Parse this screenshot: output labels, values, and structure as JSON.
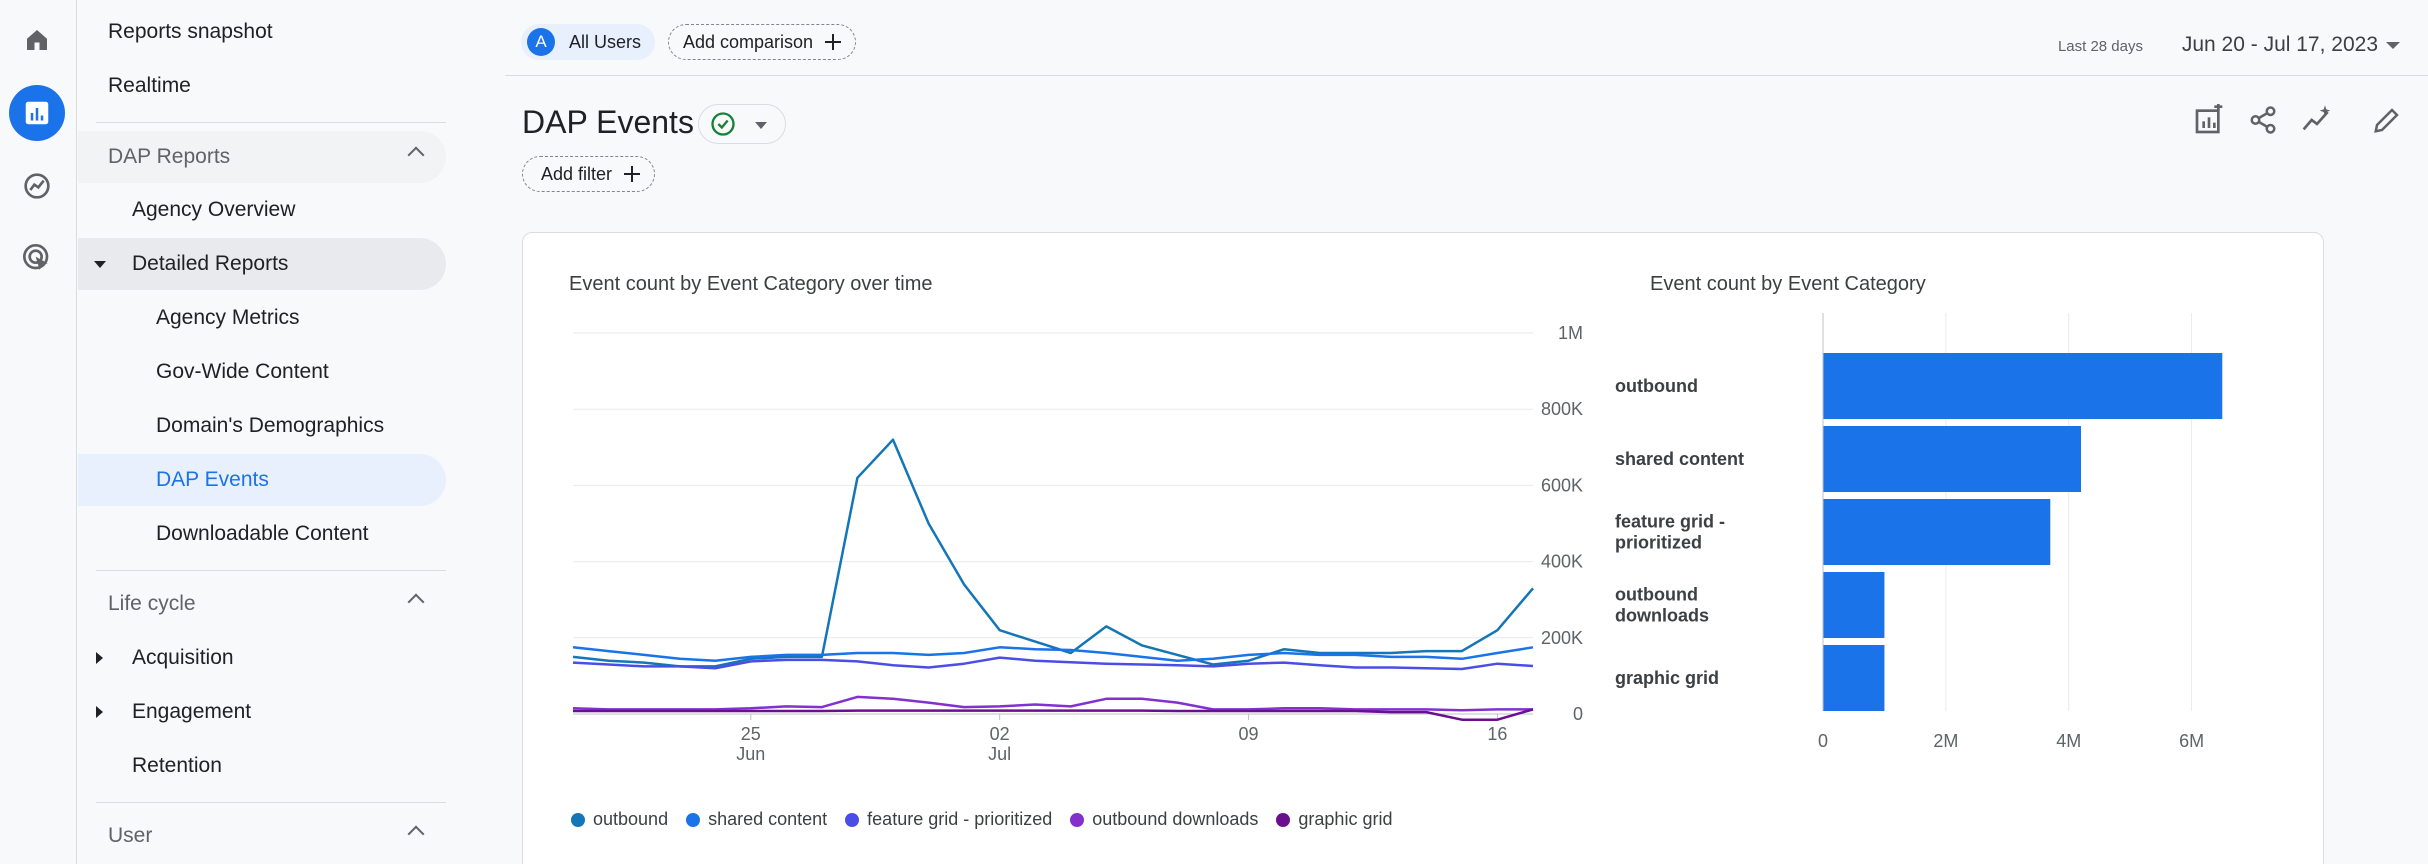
{
  "nav": {
    "items": [
      {
        "label": "Reports snapshot"
      },
      {
        "label": "Realtime"
      }
    ],
    "dap_section": {
      "label": "DAP Reports"
    },
    "agency_overview": "Agency Overview",
    "detailed_reports": "Detailed Reports",
    "detailed_children": [
      "Agency Metrics",
      "Gov-Wide Content",
      "Domain's Demographics",
      "DAP Events",
      "Downloadable Content"
    ],
    "lifecycle_section": "Life cycle",
    "lifecycle_children": [
      "Acquisition",
      "Engagement",
      "Retention"
    ],
    "user_section": "User"
  },
  "topbar": {
    "segment_avatar": "A",
    "segment_label": "All Users",
    "compare_label": "Add comparison",
    "date_caption": "Last 28 days",
    "date_range": "Jun 20 - Jul 17, 2023"
  },
  "page": {
    "title": "DAP Events",
    "add_filter": "Add filter"
  },
  "colors": {
    "outbound": "#1576b7",
    "shared_content": "#1a73e8",
    "feature_grid": "#4a4ee6",
    "outbound_downloads": "#8430ce",
    "graphic_grid": "#6a0f8e",
    "bar": "#1a73e8"
  },
  "chart_data": [
    {
      "type": "line",
      "title": "Event count by Event Category over time",
      "x_tick_labels": [
        {
          "day": "25",
          "month": "Jun"
        },
        {
          "day": "02",
          "month": "Jul"
        },
        {
          "day": "09",
          "month": ""
        },
        {
          "day": "16",
          "month": ""
        }
      ],
      "x": [
        "Jun 20",
        "Jun 21",
        "Jun 22",
        "Jun 23",
        "Jun 24",
        "Jun 25",
        "Jun 26",
        "Jun 27",
        "Jun 28",
        "Jun 29",
        "Jun 30",
        "Jul 1",
        "Jul 2",
        "Jul 3",
        "Jul 4",
        "Jul 5",
        "Jul 6",
        "Jul 7",
        "Jul 8",
        "Jul 9",
        "Jul 10",
        "Jul 11",
        "Jul 12",
        "Jul 13",
        "Jul 14",
        "Jul 15",
        "Jul 16",
        "Jul 17"
      ],
      "y_ticks": [
        "0",
        "200K",
        "400K",
        "600K",
        "800K",
        "1M"
      ],
      "ylim": [
        0,
        1000000
      ],
      "series": [
        {
          "name": "outbound",
          "values": [
            150000,
            140000,
            135000,
            125000,
            125000,
            145000,
            150000,
            150000,
            620000,
            720000,
            500000,
            340000,
            220000,
            190000,
            160000,
            230000,
            180000,
            155000,
            130000,
            140000,
            170000,
            160000,
            160000,
            160000,
            165000,
            165000,
            220000,
            330000
          ]
        },
        {
          "name": "shared content",
          "values": [
            175000,
            165000,
            155000,
            145000,
            140000,
            150000,
            155000,
            155000,
            160000,
            160000,
            155000,
            160000,
            175000,
            170000,
            168000,
            160000,
            150000,
            140000,
            145000,
            155000,
            160000,
            155000,
            155000,
            150000,
            150000,
            145000,
            160000,
            175000
          ]
        },
        {
          "name": "feature grid - prioritized",
          "values": [
            135000,
            130000,
            125000,
            125000,
            120000,
            138000,
            142000,
            142000,
            138000,
            128000,
            122000,
            132000,
            148000,
            140000,
            136000,
            132000,
            130000,
            128000,
            125000,
            132000,
            135000,
            128000,
            122000,
            122000,
            120000,
            118000,
            132000,
            126000
          ]
        },
        {
          "name": "outbound downloads",
          "values": [
            15000,
            12000,
            12000,
            12000,
            12000,
            15000,
            20000,
            18000,
            45000,
            40000,
            30000,
            18000,
            20000,
            25000,
            20000,
            40000,
            40000,
            30000,
            12000,
            12000,
            15000,
            15000,
            12000,
            12000,
            12000,
            10000,
            12000,
            12000
          ]
        },
        {
          "name": "graphic grid",
          "values": [
            8000,
            8000,
            8000,
            8000,
            8000,
            8000,
            8000,
            8000,
            9000,
            9000,
            9000,
            9000,
            9000,
            9000,
            9000,
            9000,
            9000,
            8000,
            8000,
            8000,
            8000,
            8000,
            8000,
            5000,
            5000,
            -15000,
            -15000,
            12000
          ]
        }
      ],
      "grid": true,
      "legend": "bottom"
    },
    {
      "type": "bar",
      "orientation": "horizontal",
      "title": "Event count by Event Category",
      "categories": [
        "outbound",
        "shared content",
        "feature grid - prioritized",
        "outbound downloads",
        "graphic grid"
      ],
      "category_display": [
        [
          "outbound"
        ],
        [
          "shared content"
        ],
        [
          "feature grid -",
          "prioritized"
        ],
        [
          "outbound",
          "downloads"
        ],
        [
          "graphic grid"
        ]
      ],
      "values": [
        6500000,
        4200000,
        3700000,
        1000000,
        1000000
      ],
      "x_ticks": [
        "0",
        "2M",
        "4M",
        "6M"
      ],
      "xlim": [
        0,
        7000000
      ],
      "grid": true
    }
  ]
}
